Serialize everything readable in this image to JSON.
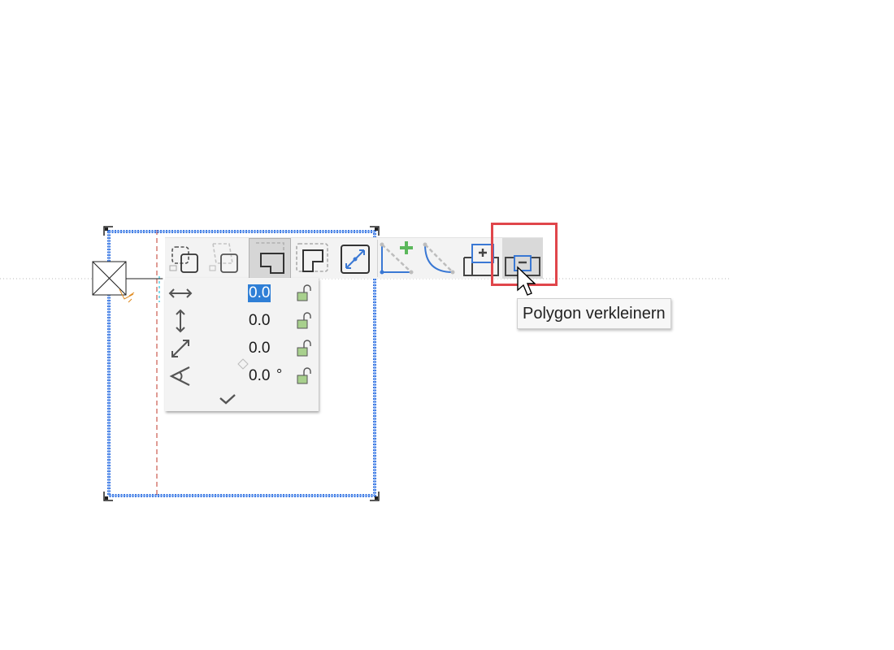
{
  "toolbar": {
    "tools": [
      {
        "name": "offset-polygon-tool",
        "icon": "offset-polygon-icon",
        "active": false,
        "disabled": false
      },
      {
        "name": "skew-polygon-tool",
        "icon": "skew-polygon-icon",
        "active": false,
        "disabled": true
      },
      {
        "name": "l-shape-tool",
        "icon": "l-shape-icon",
        "active": true,
        "disabled": false
      },
      {
        "name": "l-shape-offset-tool",
        "icon": "l-shape-offset-icon",
        "active": false,
        "disabled": false
      },
      {
        "name": "diagonal-tool",
        "icon": "diagonal-square-icon",
        "active": false,
        "disabled": false
      },
      {
        "name": "add-vertex-tool",
        "icon": "add-vertex-icon",
        "active": false,
        "disabled": false
      },
      {
        "name": "arc-tool",
        "icon": "arc-icon",
        "active": false,
        "disabled": false
      },
      {
        "name": "enlarge-polygon-tool",
        "icon": "enlarge-polygon-icon",
        "active": false,
        "disabled": false
      },
      {
        "name": "shrink-polygon-tool",
        "icon": "shrink-polygon-icon",
        "active": false,
        "disabled": false,
        "hovered": true
      }
    ]
  },
  "panel": {
    "rows": [
      {
        "icon": "horizontal-distance-icon",
        "value": "0.0",
        "unit": "",
        "selected": true,
        "locked": false
      },
      {
        "icon": "vertical-distance-icon",
        "value": "0.0",
        "unit": "",
        "selected": false,
        "locked": false
      },
      {
        "icon": "diagonal-distance-icon",
        "value": "0.0",
        "unit": "",
        "selected": false,
        "locked": false
      },
      {
        "icon": "angle-icon",
        "value": "0.0",
        "unit": "°",
        "selected": false,
        "locked": false
      }
    ],
    "confirm_icon": "checkmark-icon"
  },
  "tooltip": {
    "text": "Polygon verkleinern"
  },
  "colors": {
    "selection_blue": "#2f6fe0",
    "highlight_red": "#e0464b",
    "lock_green": "#a8d08d",
    "icon_blue": "#3a78d4",
    "icon_green": "#5cb85c"
  }
}
